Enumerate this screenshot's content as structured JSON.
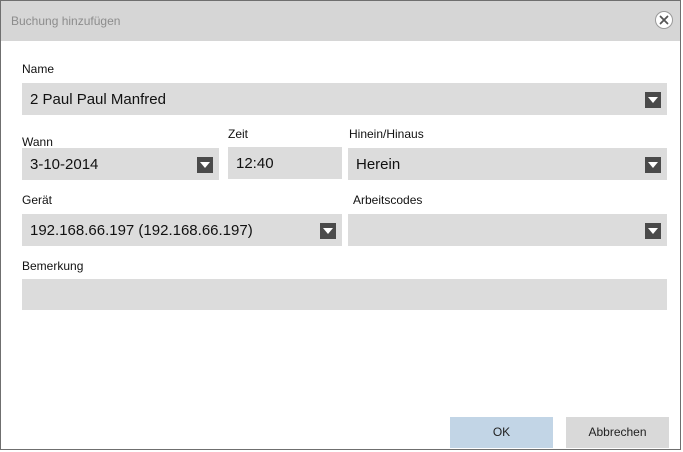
{
  "dialog": {
    "title": "Buchung hinzufügen"
  },
  "fields": {
    "name": {
      "label": "Name",
      "value": "2 Paul Paul Manfred"
    },
    "wann": {
      "label": "Wann",
      "value": "3-10-2014"
    },
    "zeit": {
      "label": "Zeit",
      "value": "12:40"
    },
    "direction": {
      "label": "Hinein/Hinaus",
      "value": "Herein"
    },
    "geraet": {
      "label": "Gerät",
      "value": "192.168.66.197 (192.168.66.197)"
    },
    "arbeitscodes": {
      "label": "Arbeitscodes",
      "value": ""
    },
    "bemerkung": {
      "label": "Bemerkung",
      "value": ""
    }
  },
  "buttons": {
    "ok": "OK",
    "cancel": "Abbrechen"
  },
  "icons": {
    "close": "close-icon",
    "dropdown": "chevron-down-icon"
  },
  "colors": {
    "titlebar": "#d6d6d6",
    "field_bg": "#dcdcdc",
    "dropdown_btn": "#4a4a4a",
    "ok_button": "#c2d5e6",
    "cancel_button": "#d9d9d9"
  }
}
